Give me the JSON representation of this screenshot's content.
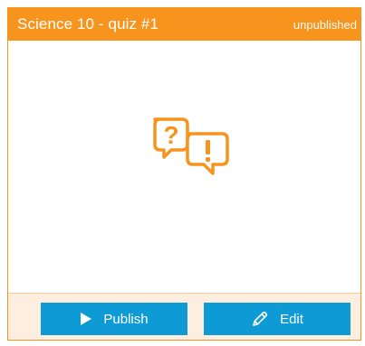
{
  "card": {
    "title": "Science 10 - quiz #1",
    "status": "unpublished",
    "icon": "quiz-question-exclamation-icon"
  },
  "actions": {
    "publish_label": "Publish",
    "publish_icon": "play-icon",
    "edit_label": "Edit",
    "edit_icon": "pencil-icon"
  },
  "colors": {
    "accent": "#F7941E",
    "footer_bg": "#FDEEDF",
    "button": "#0E9AD4"
  }
}
